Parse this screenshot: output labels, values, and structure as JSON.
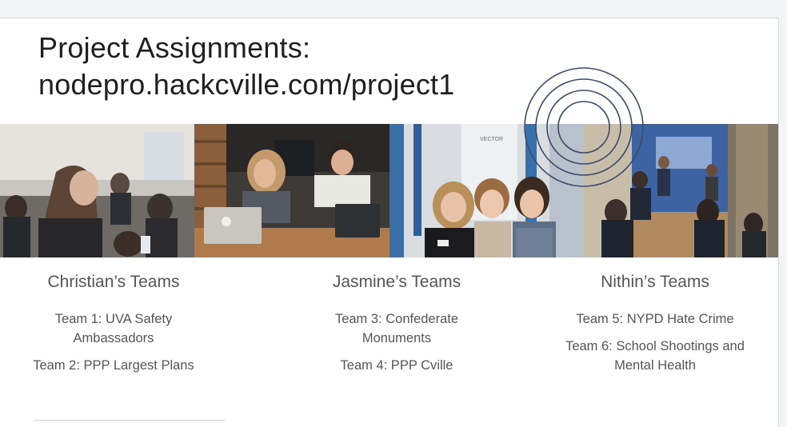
{
  "slide": {
    "title_line1": "Project Assignments:",
    "title_line2": "nodepro.hackcville.com/project1"
  },
  "photos": {
    "photo3_sign": "VECTOR"
  },
  "columns": [
    {
      "heading": "Christian’s Teams",
      "items": [
        "Team 1: UVA Safety Ambassadors",
        "Team 2: PPP Largest Plans"
      ]
    },
    {
      "heading": "Jasmine’s Teams",
      "items": [
        "Team 3: Confederate Monuments",
        "Team 4: PPP Cville"
      ]
    },
    {
      "heading": "Nithin’s Teams",
      "items": [
        "Team 5:  NYPD Hate Crime",
        "Team 6: School Shootings and Mental Health"
      ]
    }
  ],
  "colors": {
    "accent_ring": "#3a4a68",
    "slide_bg": "#ffffff",
    "page_bg": "#f3f4f6"
  }
}
